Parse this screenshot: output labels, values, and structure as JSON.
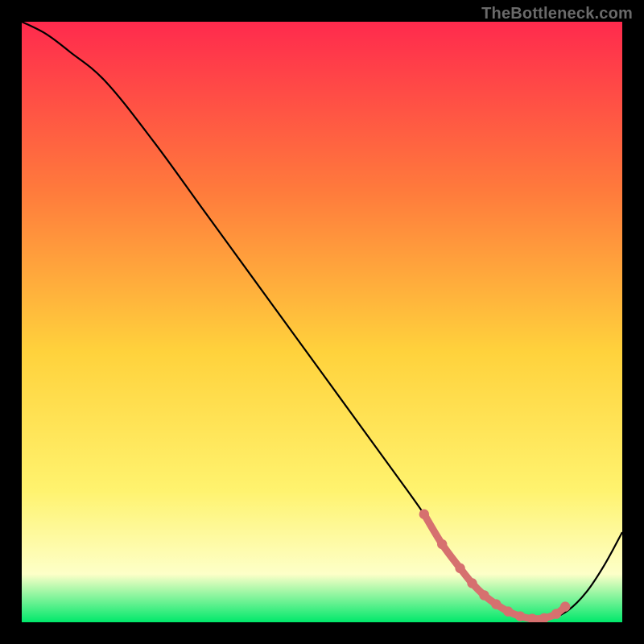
{
  "watermark": "TheBottleneck.com",
  "colors": {
    "page_bg": "#000000",
    "gradient_top": "#ff2a4d",
    "gradient_mid1": "#ff7a3c",
    "gradient_mid2": "#ffd23c",
    "gradient_low1": "#fff36e",
    "gradient_low2": "#fdffc8",
    "gradient_bottom": "#00e86b",
    "curve": "#000000",
    "marker": "#d6706f"
  },
  "chart_data": {
    "type": "line",
    "title": "",
    "xlabel": "",
    "ylabel": "",
    "xlim": [
      0,
      100
    ],
    "ylim": [
      0,
      100
    ],
    "series": [
      {
        "name": "bottleneck-curve",
        "x": [
          0,
          4,
          8,
          14,
          22,
          30,
          38,
          46,
          54,
          62,
          67,
          70,
          73,
          76,
          79,
          82,
          85,
          88,
          91,
          94,
          97,
          100
        ],
        "y": [
          100,
          98,
          95,
          90,
          80,
          69,
          58,
          47,
          36,
          25,
          18,
          13,
          9,
          5.5,
          3,
          1.5,
          0.6,
          0.6,
          2,
          5,
          9.5,
          15
        ]
      }
    ],
    "markers": {
      "name": "valley-markers",
      "x": [
        67,
        70,
        73,
        75,
        77,
        79,
        81,
        83,
        85,
        87,
        89,
        90.5
      ],
      "y": [
        18,
        13,
        9,
        6.5,
        4.5,
        3,
        1.8,
        1.0,
        0.6,
        0.7,
        1.4,
        2.6
      ]
    }
  }
}
